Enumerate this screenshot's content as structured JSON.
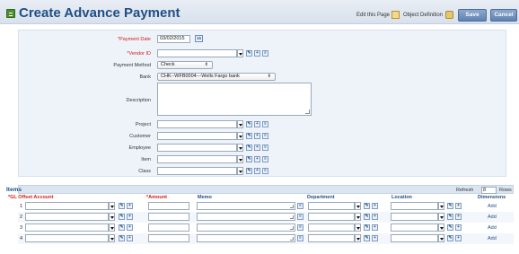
{
  "header": {
    "title": "Create Advance Payment",
    "edit_page_label": "Edit this Page",
    "object_definition_label": "Object Definition",
    "save_label": "Save",
    "cancel_label": "Cancel"
  },
  "form": {
    "payment_date": {
      "label": "*Payment Date",
      "value": "03/02/2015"
    },
    "vendor_id": {
      "label": "*Vendor ID",
      "value": ""
    },
    "payment_method": {
      "label": "Payment Method",
      "value": "Check"
    },
    "bank": {
      "label": "Bank",
      "value": "CHK--WFB0004---Wells Fargo bank"
    },
    "description": {
      "label": "Description",
      "value": ""
    },
    "project": {
      "label": "Project",
      "value": ""
    },
    "customer": {
      "label": "Customer",
      "value": ""
    },
    "employee": {
      "label": "Employee",
      "value": ""
    },
    "item": {
      "label": "Item",
      "value": ""
    },
    "class": {
      "label": "Class",
      "value": ""
    }
  },
  "items": {
    "title": "Items",
    "refresh_label": "Refresh",
    "rows_value": "8",
    "rows_label": "Rows",
    "columns": {
      "gl_offset": "*GL Offset Account",
      "amount": "*Amount",
      "memo": "Memo",
      "department": "Department",
      "location": "Location",
      "dimensions": "Dimensions"
    },
    "rows": [
      {
        "num": "1",
        "add": "Add"
      },
      {
        "num": "2",
        "add": "Add"
      },
      {
        "num": "3",
        "add": "Add"
      },
      {
        "num": "4",
        "add": "Add"
      }
    ]
  },
  "icons": {
    "calendar": "calendar-icon",
    "edit": "edit-icon",
    "add": "add-icon",
    "list": "list-icon",
    "dropdown": "dropdown-arrow-icon"
  },
  "colors": {
    "title": "#1f4f86",
    "required": "#d0201a",
    "button": "#6f8fbc",
    "panel": "#eef3f9"
  }
}
